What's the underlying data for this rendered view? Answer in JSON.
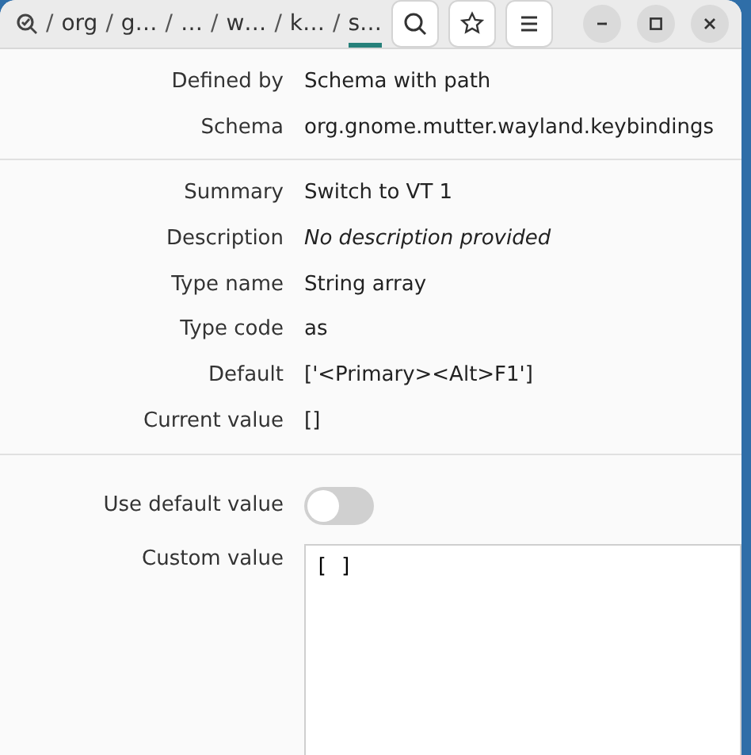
{
  "breadcrumb": [
    {
      "separator": "/",
      "label": "org",
      "selected": false
    },
    {
      "separator": "/",
      "label": "g…",
      "selected": false
    },
    {
      "separator": "/",
      "label": "…",
      "selected": false
    },
    {
      "separator": "/",
      "label": "w…",
      "selected": false
    },
    {
      "separator": "/",
      "label": "k…",
      "selected": false
    },
    {
      "separator": "/",
      "label": "s…",
      "selected": true
    }
  ],
  "sections": [
    {
      "rows": [
        {
          "label": "Defined by",
          "value": "Schema with path",
          "italic": false
        },
        {
          "label": "Schema",
          "value": "org.gnome.mutter.wayland.keybindings",
          "italic": false
        }
      ]
    },
    {
      "rows": [
        {
          "label": "Summary",
          "value": "Switch to VT 1",
          "italic": false
        },
        {
          "label": "Description",
          "value": "No description provided",
          "italic": true
        },
        {
          "label": "Type name",
          "value": "String array",
          "italic": false
        },
        {
          "label": "Type code",
          "value": "as",
          "italic": false
        },
        {
          "label": "Default",
          "value": "['<Primary><Alt>F1']",
          "italic": false
        },
        {
          "label": "Current value",
          "value": "[]",
          "italic": false
        }
      ]
    }
  ],
  "use_default": {
    "label": "Use default value",
    "on": false
  },
  "custom": {
    "label": "Custom value",
    "value": "[ ]"
  }
}
